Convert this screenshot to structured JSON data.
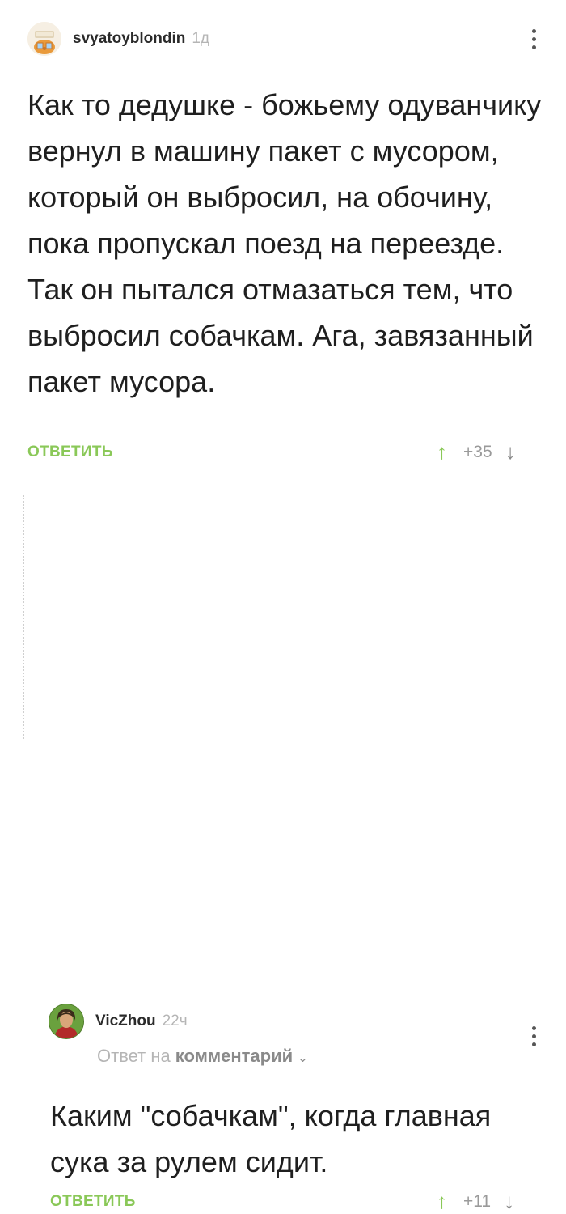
{
  "comment1": {
    "author": "svyatoyblondin",
    "time": "1д",
    "text": "Как то дедушке - божьему одуванчику вернул в машину пакет с мусором, который он выбросил, на обочину, пока пропускал поезд на переезде. Так он пытался отмазаться тем, что выбросил собачкам. Ага, завязанный пакет мусора.",
    "reply_label": "ОТВЕТИТЬ",
    "score": "+35",
    "icons": {
      "avatar": "cartoon-avatar-icon",
      "menu": "more-vertical-icon",
      "up": "arrow-up-icon",
      "down": "arrow-down-icon"
    }
  },
  "comment2": {
    "author": "VicZhou",
    "time": "22ч",
    "reply_to_prefix": "Ответ на",
    "reply_to_target": "комментарий",
    "text": "Каким \"собачкам\", когда главная сука за рулем сидит.",
    "reply_label": "ОТВЕТИТЬ",
    "score": "+11",
    "icons": {
      "avatar": "user-photo-avatar-icon",
      "menu": "more-vertical-icon",
      "up": "arrow-up-icon",
      "down": "arrow-down-icon"
    }
  },
  "colors": {
    "accent": "#8ac858",
    "text": "#1f1f1f",
    "muted": "#b5b5b5"
  }
}
